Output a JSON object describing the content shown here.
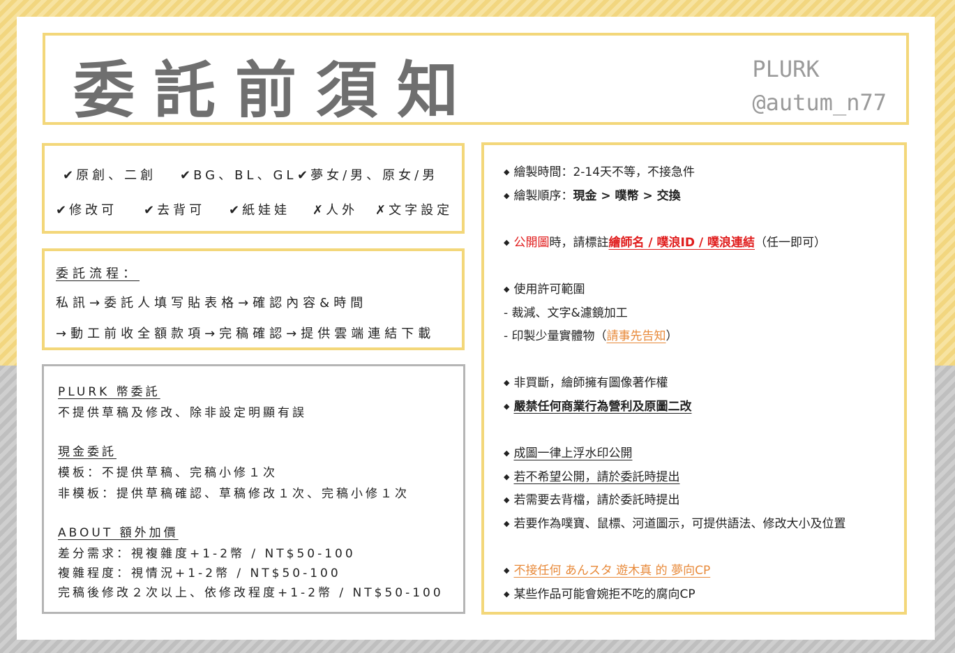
{
  "title": "委託前須知",
  "plurk": {
    "line1": "PLURK",
    "line2": "@autum_n77"
  },
  "tags": [
    {
      "mark": "✔",
      "text": "原創、二創"
    },
    {
      "mark": "✔",
      "text": "BG、BL、GL"
    },
    {
      "mark": "✔",
      "text": "夢女/男、原女/男"
    },
    {
      "mark": "✔",
      "text": "修改可"
    },
    {
      "mark": "✔",
      "text": "去背可"
    },
    {
      "mark": "✔",
      "text": "紙娃娃"
    },
    {
      "mark": "✗",
      "text": "人外"
    },
    {
      "mark": "✗",
      "text": "文字設定"
    }
  ],
  "flow": {
    "heading": "委託流程：",
    "line1": "私訊→委託人填写貼表格→確認內容&時間",
    "line2": "→動工前收全額款項→完稿確認→提供雲端連結下載"
  },
  "pricing": {
    "plurk_heading": "PLURK 幣委託",
    "plurk_note": "不提供草稿及修改、除非設定明顯有誤",
    "cash_heading": "現金委託",
    "cash_template": "模板：不提供草稿、完稿小修１次",
    "cash_nontemplate": "非模板：提供草稿確認、草稿修改１次、完稿小修１次",
    "about_heading": " ABOUT 額外加價",
    "extra1": "差分需求：視複雜度+1-2幣 / NT$50-100",
    "extra2": "複雜程度：視情況+1-2幣 / NT$50-100",
    "extra3": "完稿後修改２次以上、依修改程度+1-2幣 / NT$50-100"
  },
  "rules": {
    "time_label": "繪製時間：",
    "time_value": "2-14天不等，不接急件",
    "order_label": "繪製順序：",
    "order_value": "現金 > 噗幣 > 交換",
    "public_red": "公開圖",
    "public_mid": "時，請標註",
    "public_link": "繪師名 / 噗浪ID / 噗浪連結",
    "public_end": "（任一即可）",
    "usage_heading": "使用許可範圍",
    "usage1": " - 裁減、文字&濾鏡加工",
    "usage2_a": " - 印製少量實體物（",
    "usage2_link": "請事先告知",
    "usage2_b": "）",
    "nonbuyout": "非買斷，繪師擁有圖像著作權",
    "forbid": "嚴禁任何商業行為營利及原圖二改",
    "watermark": "成圖一律上浮水印公開",
    "nopublic": "若不希望公開，請於委託時提出",
    "removebg": "若需要去背檔，請於委託時提出",
    "emoji": "若要作為噗寶、鼠標、河道圖示，可提供語法、修改大小及位置",
    "nocp": "不接任何 あんスタ 遊木真 的 夢向CP",
    "somecp": "某些作品可能會婉拒不吃的腐向CP"
  },
  "colors": {
    "accent_yellow": "#f3d77a",
    "border_gray": "#b5b5b5",
    "red": "#e01b1b",
    "orange": "#e88a3a"
  }
}
